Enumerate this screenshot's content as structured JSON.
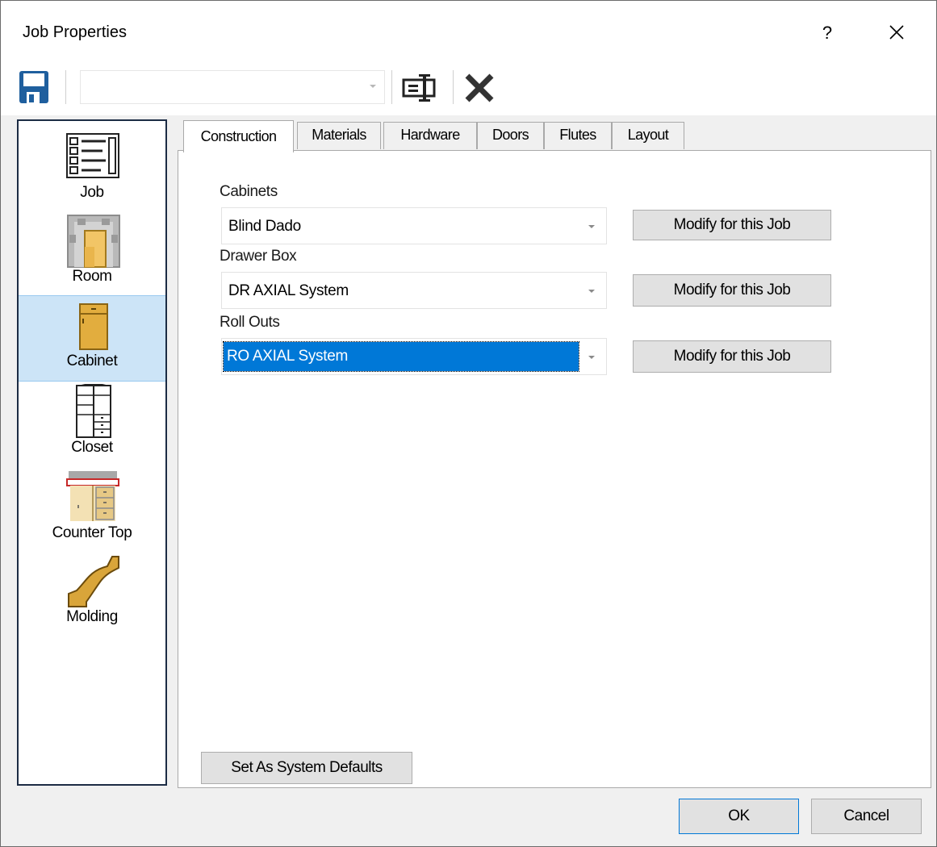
{
  "window": {
    "title": "Job Properties",
    "help": "?"
  },
  "toolbar": {
    "profile_value": "",
    "icons": [
      "save-icon",
      "rename-icon",
      "delete-icon"
    ]
  },
  "sidebar": {
    "items": [
      {
        "label": "Job",
        "icon": "job-list-icon"
      },
      {
        "label": "Room",
        "icon": "room-icon"
      },
      {
        "label": "Cabinet",
        "icon": "cabinet-icon",
        "selected": true
      },
      {
        "label": "Closet",
        "icon": "closet-icon"
      },
      {
        "label": "Counter Top",
        "icon": "counter-top-icon"
      },
      {
        "label": "Molding",
        "icon": "molding-icon"
      }
    ]
  },
  "tabs": [
    {
      "label": "Construction",
      "active": true
    },
    {
      "label": "Materials"
    },
    {
      "label": "Hardware"
    },
    {
      "label": "Doors"
    },
    {
      "label": "Flutes"
    },
    {
      "label": "Layout"
    }
  ],
  "construction": {
    "fields": [
      {
        "label": "Cabinets",
        "value": "Blind Dado",
        "button": "Modify for this Job"
      },
      {
        "label": "Drawer Box",
        "value": "DR AXIAL System",
        "button": "Modify for this Job"
      },
      {
        "label": "Roll Outs",
        "value": "RO AXIAL System",
        "button": "Modify for this Job",
        "focused": true
      }
    ],
    "defaults_button": "Set As System Defaults"
  },
  "footer": {
    "ok": "OK",
    "cancel": "Cancel"
  },
  "colors": {
    "selection": "#0078d7",
    "sidebar_selected": "#cce4f7",
    "icon_wood": "#e8b84a",
    "save_blue": "#1f5f9e"
  }
}
